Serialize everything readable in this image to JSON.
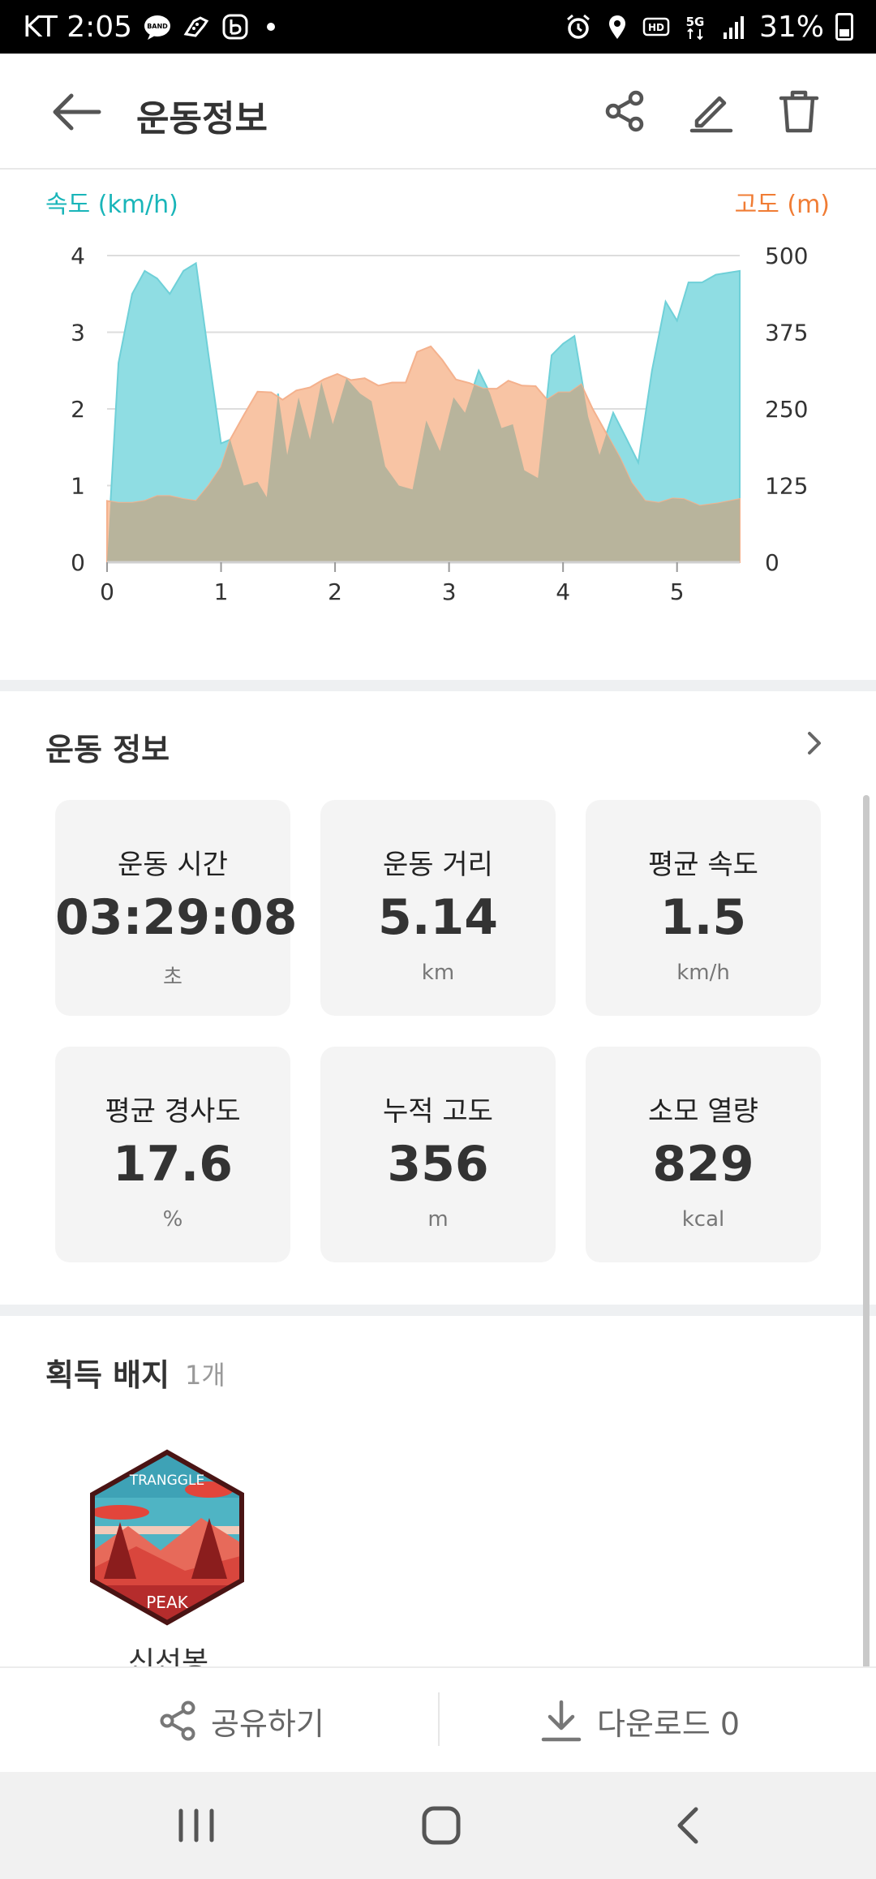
{
  "status_bar": {
    "carrier_time": "KT 2:05",
    "battery": "31%",
    "left_icons": [
      "band-icon",
      "shoe-icon",
      "b-app-icon",
      "dot-icon"
    ],
    "right_icons": [
      "alarm-icon",
      "location-icon",
      "hd-icon",
      "5g-icon",
      "signal-icon",
      "battery-icon"
    ]
  },
  "appbar": {
    "title": "운동정보",
    "actions": [
      "share-icon",
      "edit-icon",
      "delete-icon"
    ]
  },
  "chart_data": {
    "type": "area",
    "left_axis_title": "속도 (km/h)",
    "right_axis_title": "고도 (m)",
    "x_ticks": [
      "0",
      "1",
      "2",
      "3",
      "4",
      "5"
    ],
    "y_left_ticks": [
      "0",
      "1",
      "2",
      "3",
      "4"
    ],
    "y_right_ticks": [
      "0",
      "125",
      "250",
      "375",
      "500"
    ],
    "xlim": [
      0,
      5.55
    ],
    "ylim_left": [
      0,
      4
    ],
    "ylim_right": [
      0,
      500
    ],
    "colors": {
      "speed": "#8fdde3",
      "altitude": "#f8c4a4",
      "overlap": "#b8b49c",
      "grid": "#dddddd"
    },
    "series": [
      {
        "name": "속도 (km/h)",
        "axis": "left",
        "x": [
          0,
          0.1,
          0.22,
          0.33,
          0.44,
          0.55,
          0.67,
          0.78,
          0.89,
          1.0,
          1.08,
          1.2,
          1.32,
          1.4,
          1.5,
          1.58,
          1.68,
          1.78,
          1.88,
          1.98,
          2.1,
          2.22,
          2.32,
          2.44,
          2.56,
          2.68,
          2.8,
          2.92,
          3.04,
          3.14,
          3.26,
          3.36,
          3.46,
          3.56,
          3.66,
          3.78,
          3.9,
          4.0,
          4.1,
          4.22,
          4.32,
          4.44,
          4.56,
          4.66,
          4.78,
          4.9,
          5.0,
          5.1,
          5.22,
          5.34,
          5.55
        ],
        "values": [
          0,
          2.6,
          3.5,
          3.8,
          3.7,
          3.5,
          3.8,
          3.9,
          2.7,
          1.55,
          1.6,
          1.0,
          1.05,
          0.85,
          2.2,
          1.4,
          2.15,
          1.6,
          2.35,
          1.8,
          2.4,
          2.2,
          2.1,
          1.25,
          1.0,
          0.95,
          1.85,
          1.45,
          2.15,
          1.95,
          2.5,
          2.2,
          1.75,
          1.8,
          1.2,
          1.1,
          2.7,
          2.85,
          2.95,
          1.9,
          1.4,
          1.95,
          1.6,
          1.3,
          2.5,
          3.4,
          3.15,
          3.65,
          3.65,
          3.75,
          3.8
        ]
      },
      {
        "name": "고도 (m)",
        "axis": "right",
        "x": [
          0,
          0.1,
          0.22,
          0.33,
          0.44,
          0.55,
          0.67,
          0.78,
          0.89,
          1.0,
          1.08,
          1.2,
          1.32,
          1.44,
          1.54,
          1.66,
          1.78,
          1.9,
          2.02,
          2.14,
          2.26,
          2.38,
          2.5,
          2.62,
          2.72,
          2.84,
          2.94,
          3.06,
          3.18,
          3.3,
          3.42,
          3.52,
          3.64,
          3.76,
          3.86,
          3.96,
          4.06,
          4.16,
          4.26,
          4.38,
          4.5,
          4.6,
          4.72,
          4.84,
          4.96,
          5.06,
          5.2,
          5.36,
          5.55
        ],
        "values": [
          100,
          97,
          97,
          100,
          108,
          108,
          103,
          100,
          125,
          155,
          200,
          240,
          278,
          277,
          265,
          280,
          285,
          298,
          307,
          297,
          300,
          288,
          293,
          293,
          343,
          352,
          330,
          298,
          292,
          283,
          283,
          296,
          288,
          287,
          265,
          277,
          277,
          290,
          250,
          210,
          170,
          130,
          100,
          97,
          104,
          103,
          92,
          96,
          103
        ]
      }
    ]
  },
  "workout_info": {
    "title": "운동 정보",
    "cards": [
      {
        "label": "운동 시간",
        "value": "03:29:08",
        "unit": "초"
      },
      {
        "label": "운동 거리",
        "value": "5.14",
        "unit": "km"
      },
      {
        "label": "평균 속도",
        "value": "1.5",
        "unit": "km/h"
      },
      {
        "label": "평균 경사도",
        "value": "17.6",
        "unit": "%"
      },
      {
        "label": "누적 고도",
        "value": "356",
        "unit": "m"
      },
      {
        "label": "소모 열량",
        "value": "829",
        "unit": "kcal"
      }
    ]
  },
  "badges": {
    "title": "획득 배지",
    "count": "1개",
    "items": [
      {
        "name": "신선봉",
        "badge_top_text": "TRANGGLE",
        "badge_bottom_text": "PEAK"
      }
    ]
  },
  "bottom_actions": {
    "share_label": "공유하기",
    "download_label": "다운로드 0"
  },
  "nav": {
    "buttons": [
      "recents-icon",
      "home-icon",
      "back-icon"
    ]
  }
}
